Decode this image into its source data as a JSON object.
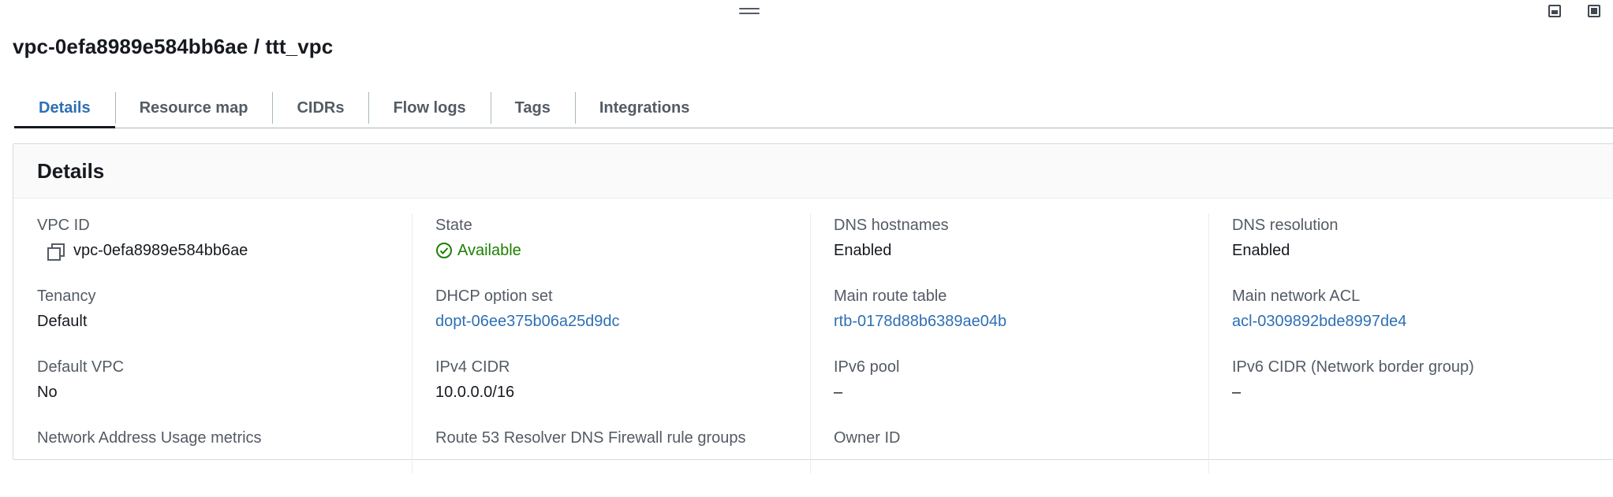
{
  "page": {
    "title": "vpc-0efa8989e584bb6ae / ttt_vpc"
  },
  "tabs": [
    {
      "label": "Details",
      "active": true
    },
    {
      "label": "Resource map"
    },
    {
      "label": "CIDRs"
    },
    {
      "label": "Flow logs"
    },
    {
      "label": "Tags"
    },
    {
      "label": "Integrations"
    }
  ],
  "details": {
    "heading": "Details",
    "columns": [
      [
        {
          "label": "VPC ID",
          "value": "vpc-0efa8989e584bb6ae",
          "icon": "copy-icon"
        },
        {
          "label": "Tenancy",
          "value": "Default"
        },
        {
          "label": "Default VPC",
          "value": "No"
        },
        {
          "label": "Network Address Usage metrics",
          "value": ""
        }
      ],
      [
        {
          "label": "State",
          "value": "Available",
          "icon": "check-circle-icon"
        },
        {
          "label": "DHCP option set",
          "value": "dopt-06ee375b06a25d9dc",
          "link": true
        },
        {
          "label": "IPv4 CIDR",
          "value": "10.0.0.0/16"
        },
        {
          "label": "Route 53 Resolver DNS Firewall rule groups",
          "value": ""
        }
      ],
      [
        {
          "label": "DNS hostnames",
          "value": "Enabled"
        },
        {
          "label": "Main route table",
          "value": "rtb-0178d88b6389ae04b",
          "link": true
        },
        {
          "label": "IPv6 pool",
          "value": "–"
        },
        {
          "label": "Owner ID",
          "value": ""
        }
      ],
      [
        {
          "label": "DNS resolution",
          "value": "Enabled"
        },
        {
          "label": "Main network ACL",
          "value": "acl-0309892bde8997de4",
          "link": true
        },
        {
          "label": "IPv6 CIDR (Network border group)",
          "value": "–"
        }
      ]
    ]
  },
  "icons": [
    "drag-handle-icon",
    "panel-bottom-icon",
    "panel-side-icon",
    "panel-right-icon",
    "copy-icon",
    "check-circle-icon"
  ],
  "colors": {
    "link": "#2e6fb4",
    "available": "#1d8102",
    "text": "#16191f",
    "label": "#545b64"
  }
}
